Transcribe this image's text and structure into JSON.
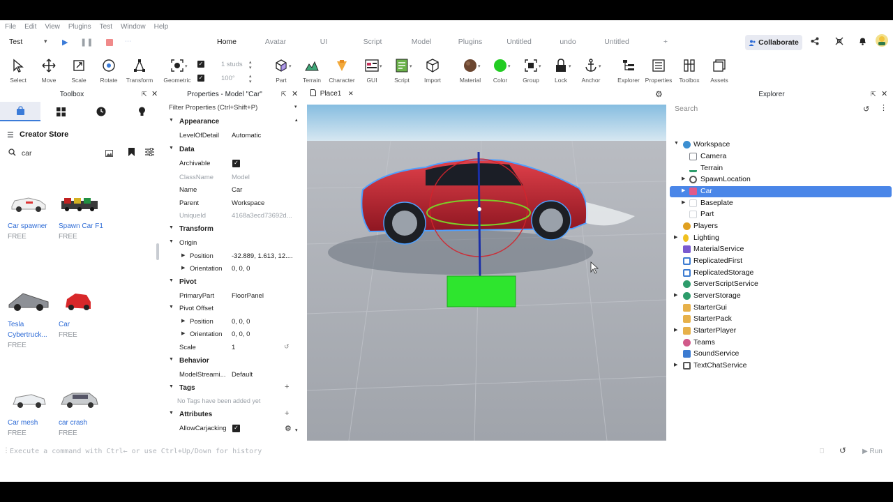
{
  "menu": [
    "File",
    "Edit",
    "View",
    "Plugins",
    "Test",
    "Window",
    "Help"
  ],
  "mode_select": "Test",
  "ribbon_tabs": [
    {
      "label": "Home",
      "active": true
    },
    {
      "label": "Avatar",
      "active": false
    },
    {
      "label": "UI",
      "active": false
    },
    {
      "label": "Script",
      "active": false
    },
    {
      "label": "Model",
      "active": false
    },
    {
      "label": "Plugins",
      "active": false
    },
    {
      "label": "Untitled",
      "active": false
    },
    {
      "label": "undo",
      "active": false
    },
    {
      "label": "Untitled",
      "active": false
    },
    {
      "label": "+",
      "active": false
    }
  ],
  "collaborate_label": "Collaborate",
  "tools": [
    "Select",
    "Move",
    "Scale",
    "Rotate",
    "Transform",
    "Geometric",
    "Part",
    "Terrain",
    "Character",
    "GUI",
    "Script",
    "Import",
    "Material",
    "Color",
    "Group",
    "Lock",
    "Anchor",
    "Explorer",
    "Properties",
    "Toolbox",
    "Assets"
  ],
  "snap": {
    "move_value": "1 studs",
    "rotate_value": "100°"
  },
  "toolbox": {
    "title": "Toolbox",
    "store_title": "Creator Store",
    "search_query": "car",
    "items": [
      {
        "name": "Car spawner",
        "price": "FREE"
      },
      {
        "name": "Spawn Car F1",
        "price": "FREE"
      },
      {
        "name": "Tesla Cybertruck...",
        "price": "FREE"
      },
      {
        "name": "Car",
        "price": "FREE"
      },
      {
        "name": "Car mesh",
        "price": "FREE"
      },
      {
        "name": "car crash",
        "price": "FREE"
      }
    ]
  },
  "properties": {
    "title": "Properties - Model \"Car\"",
    "filter_placeholder": "Filter Properties (Ctrl+Shift+P)",
    "sections": {
      "appearance": "Appearance",
      "data": "Data",
      "transform": "Transform",
      "pivot": "Pivot",
      "behavior": "Behavior",
      "tags": "Tags",
      "attributes": "Attributes"
    },
    "rows": {
      "level_of_detail": {
        "key": "LevelOfDetail",
        "value": "Automatic"
      },
      "archivable": {
        "key": "Archivable"
      },
      "class_name": {
        "key": "ClassName",
        "value": "Model"
      },
      "name": {
        "key": "Name",
        "value": "Car"
      },
      "parent": {
        "key": "Parent",
        "value": "Workspace"
      },
      "unique_id": {
        "key": "UniqueId",
        "value": "4168a3ecd73692d..."
      },
      "origin": {
        "key": "Origin"
      },
      "origin_position": {
        "key": "Position",
        "value": "-32.889, 1.613, 12...."
      },
      "origin_orientation": {
        "key": "Orientation",
        "value": "0, 0, 0"
      },
      "primary_part": {
        "key": "PrimaryPart",
        "value": "FloorPanel"
      },
      "pivot_offset": {
        "key": "Pivot Offset"
      },
      "pivot_position": {
        "key": "Position",
        "value": "0, 0, 0"
      },
      "pivot_orientation": {
        "key": "Orientation",
        "value": "0, 0, 0"
      },
      "scale": {
        "key": "Scale",
        "value": "1"
      },
      "model_streaming": {
        "key": "ModelStreami...",
        "value": "Default"
      },
      "no_tags": "No Tags have been added yet",
      "allow_carjacking": {
        "key": "AllowCarjacking"
      }
    }
  },
  "document_tab": "Place1",
  "explorer": {
    "title": "Explorer",
    "search_placeholder": "Search",
    "items": [
      {
        "label": "Workspace",
        "icon": "globe-icon",
        "color": "#3c8fd1"
      },
      {
        "label": "Camera",
        "icon": "camera-icon",
        "color": "#7c8088"
      },
      {
        "label": "Terrain",
        "icon": "terrain-icon",
        "color": "#2d9c6b"
      },
      {
        "label": "SpawnLocation",
        "icon": "gear-icon",
        "color": "#555555"
      },
      {
        "label": "Car",
        "icon": "model-icon",
        "color": "#e05a8a"
      },
      {
        "label": "Baseplate",
        "icon": "part-icon",
        "color": "#cfd3d8"
      },
      {
        "label": "Part",
        "icon": "part-icon",
        "color": "#cfd3d8"
      },
      {
        "label": "Players",
        "icon": "players-icon",
        "color": "#e0a020"
      },
      {
        "label": "Lighting",
        "icon": "lightbulb-icon",
        "color": "#f0c020"
      },
      {
        "label": "MaterialService",
        "icon": "material-icon",
        "color": "#7a5ad0"
      },
      {
        "label": "ReplicatedFirst",
        "icon": "replicated-icon",
        "color": "#3c7bd1"
      },
      {
        "label": "ReplicatedStorage",
        "icon": "replicated-icon",
        "color": "#3c7bd1"
      },
      {
        "label": "ServerScriptService",
        "icon": "server-icon",
        "color": "#2d9c6b"
      },
      {
        "label": "ServerStorage",
        "icon": "server-icon",
        "color": "#2d9c6b"
      },
      {
        "label": "StarterGui",
        "icon": "folder-icon",
        "color": "#e7b14a"
      },
      {
        "label": "StarterPack",
        "icon": "folder-icon",
        "color": "#e7b14a"
      },
      {
        "label": "StarterPlayer",
        "icon": "folder-icon",
        "color": "#e7b14a"
      },
      {
        "label": "Teams",
        "icon": "teams-icon",
        "color": "#d15a8a"
      },
      {
        "label": "SoundService",
        "icon": "sound-icon",
        "color": "#3c7bd1"
      },
      {
        "label": "TextChatService",
        "icon": "chat-icon",
        "color": "#555555"
      }
    ]
  },
  "command_bar": {
    "placeholder": "Execute a command with Ctrl← or use Ctrl+Up/Down for history",
    "run_label": "Run"
  },
  "colors": {
    "accent": "#3b7bd8",
    "selection": "#4a86e8",
    "viewport_sky": "#a9cbe3",
    "ground": "#a6aab2"
  }
}
